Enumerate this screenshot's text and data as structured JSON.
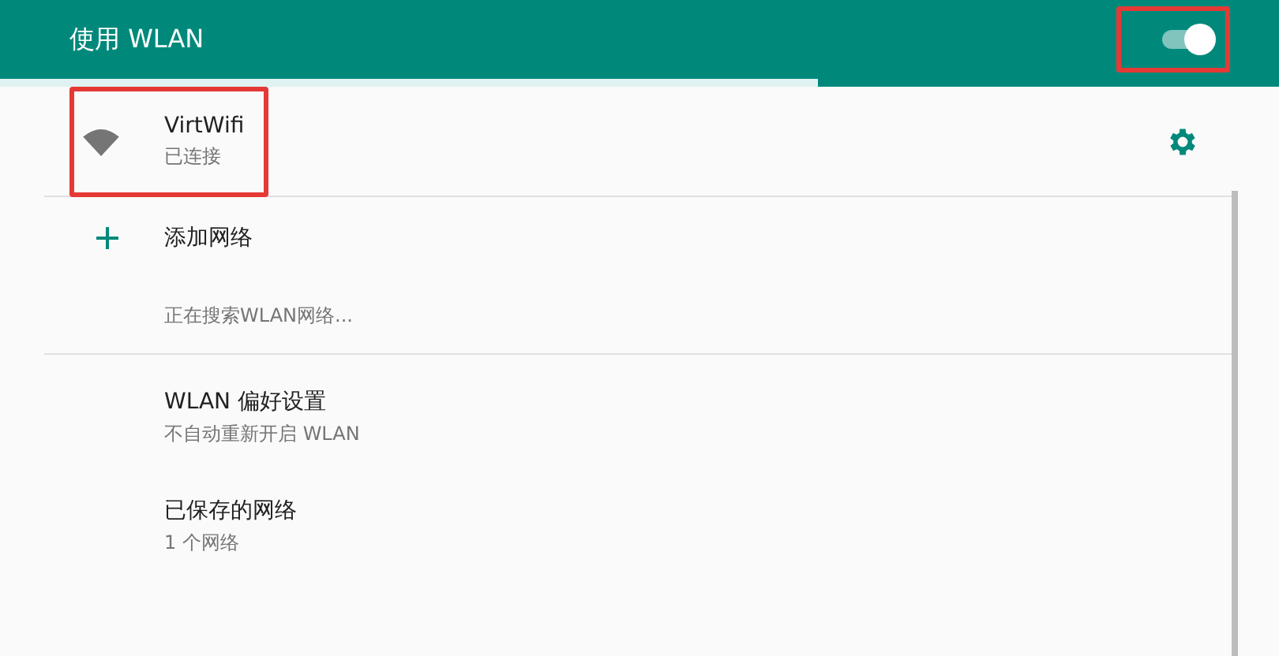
{
  "header": {
    "title": "使用 WLAN",
    "switch_on": true
  },
  "scan_progress": {
    "level": 0.64
  },
  "connected": {
    "name": "VirtWifi",
    "status": "已连接"
  },
  "add_network": {
    "label": "添加网络"
  },
  "searching_text": "正在搜索WLAN网络...",
  "settings": [
    {
      "title": "WLAN 偏好设置",
      "subtitle": "不自动重新开启 WLAN"
    },
    {
      "title": "已保存的网络",
      "subtitle": "1 个网络"
    }
  ]
}
